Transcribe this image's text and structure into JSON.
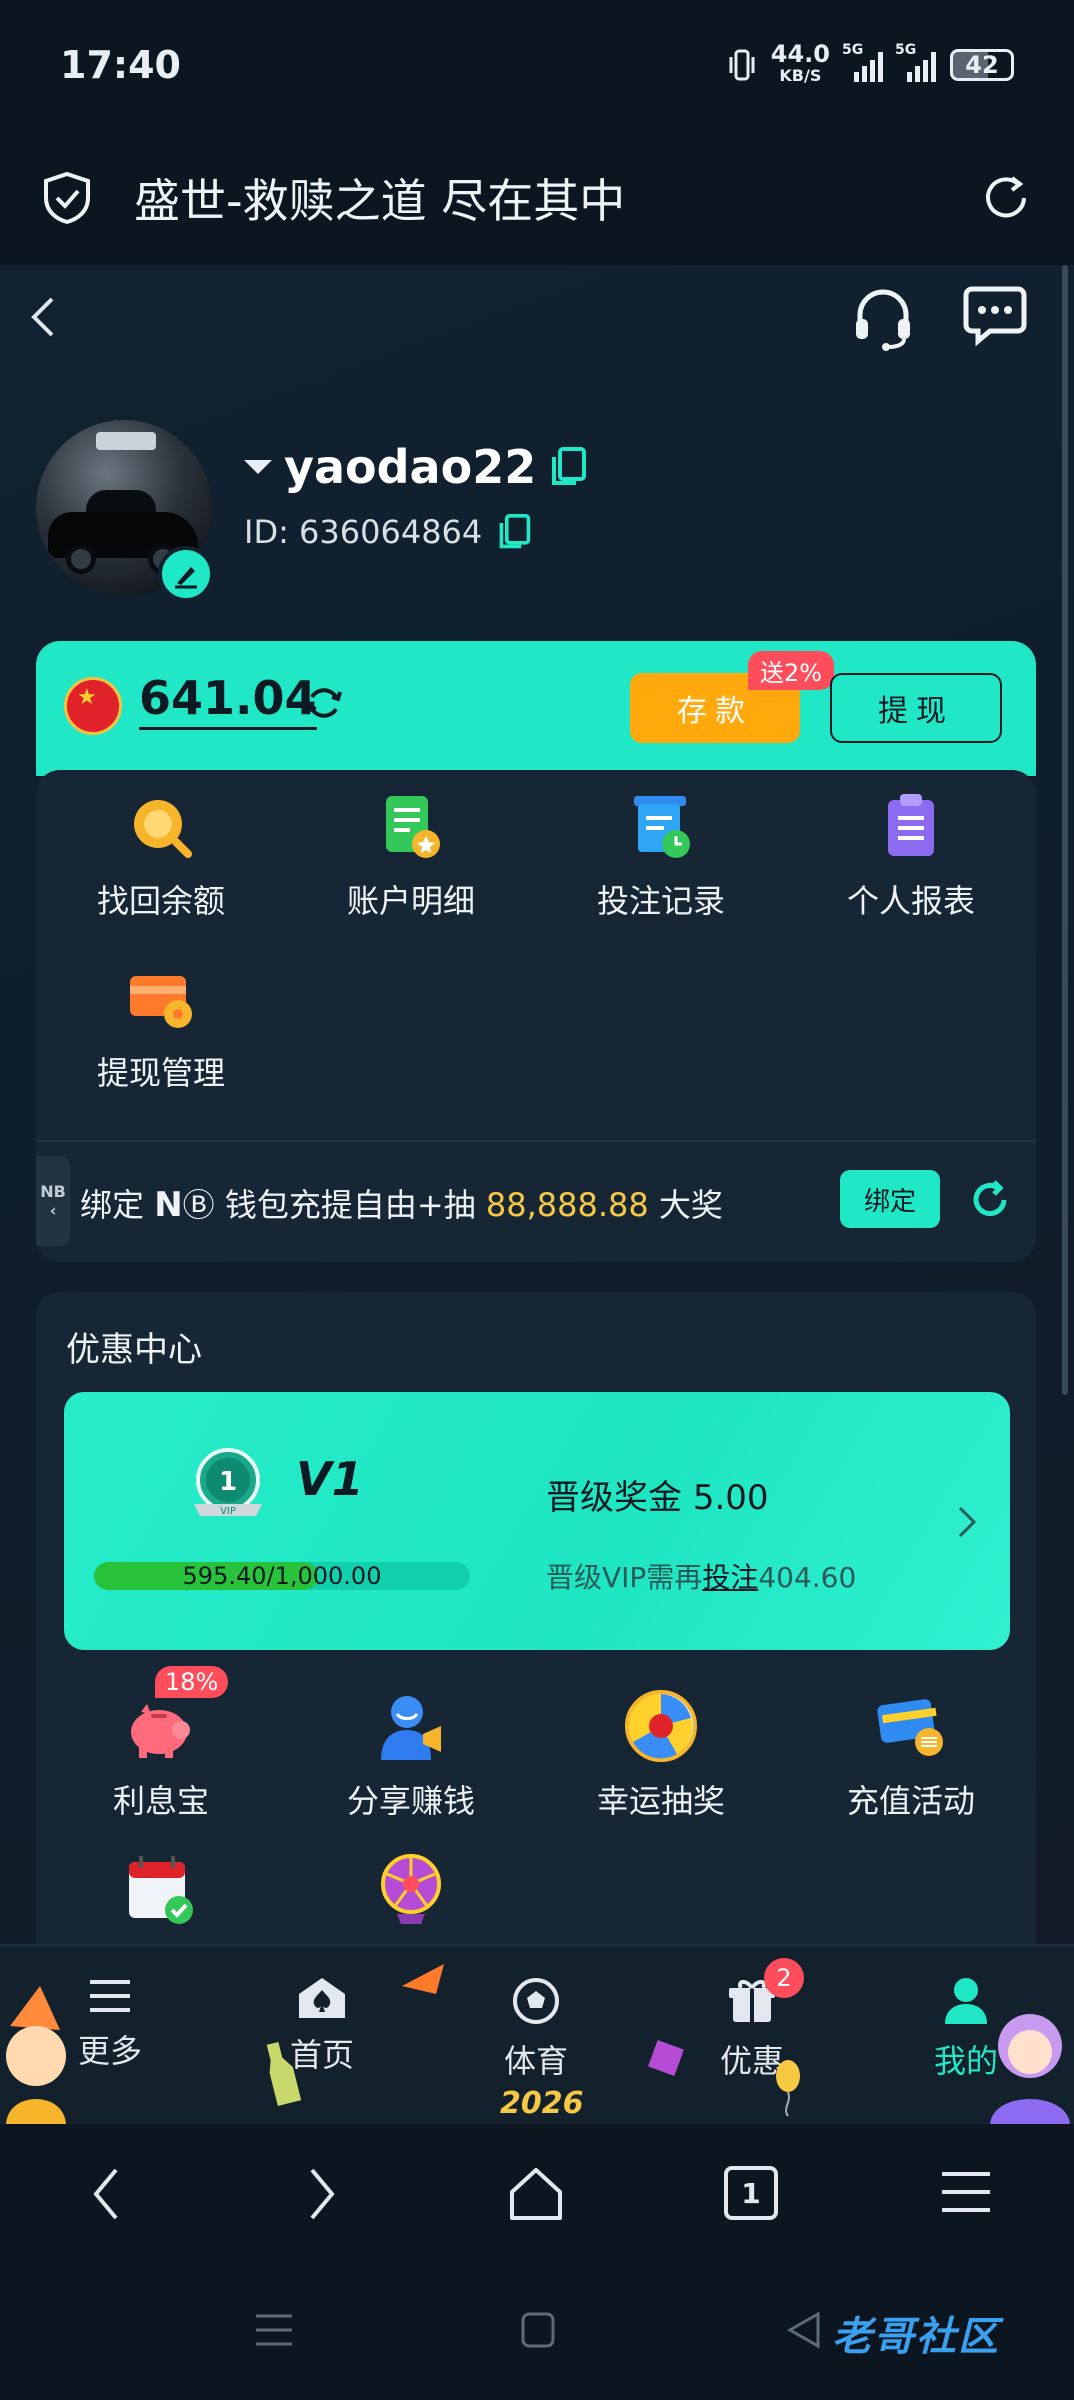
{
  "status_bar": {
    "time": "17:40",
    "net_speed": "44.0",
    "net_unit": "KB/S",
    "signal_1": "5G",
    "signal_2": "5G",
    "battery": "42"
  },
  "browser": {
    "title": "盛世-救赎之道 尽在其中"
  },
  "profile": {
    "username": "yaodao22",
    "id_label": "ID: 636064864"
  },
  "wallet": {
    "balance": "641.04",
    "deposit_label": "存款",
    "deposit_badge": "送2%",
    "withdraw_label": "提现"
  },
  "account_menu": [
    {
      "label": "找回余额",
      "icon": "coin-search-icon"
    },
    {
      "label": "账户明细",
      "icon": "statement-icon"
    },
    {
      "label": "投注记录",
      "icon": "bet-record-icon"
    },
    {
      "label": "个人报表",
      "icon": "report-icon"
    },
    {
      "label": "提现管理",
      "icon": "card-settings-icon"
    }
  ],
  "promo": {
    "tab_letters": "NB",
    "text_prefix": "绑定",
    "text_brand": "N",
    "text_mid": "钱包充提自由+抽",
    "text_amount": "88,888.88",
    "text_suffix": "大奖",
    "bind_label": "绑定"
  },
  "offers": {
    "title": "优惠中心",
    "vip": {
      "medal_number": "1",
      "medal_label": "VIP",
      "level": "V1",
      "progress_text": "595.40/1,000.00",
      "progress_fraction": 0.5954,
      "bonus_label": "晋级奖金",
      "bonus_value": "5.00",
      "need_prefix": "晋级VIP需再",
      "need_link": "投注",
      "need_value": "404.60"
    },
    "items": [
      {
        "label": "利息宝",
        "icon": "piggy-bank-icon",
        "badge": "18%"
      },
      {
        "label": "分享赚钱",
        "icon": "share-megaphone-icon"
      },
      {
        "label": "幸运抽奖",
        "icon": "lucky-wheel-icon"
      },
      {
        "label": "充值活动",
        "icon": "recharge-card-icon"
      }
    ]
  },
  "tabbar": [
    {
      "label": "更多",
      "icon": "menu-icon"
    },
    {
      "label": "首页",
      "icon": "home-spade-icon"
    },
    {
      "label": "体育",
      "icon": "soccer-ball-icon"
    },
    {
      "label": "优惠",
      "icon": "gift-icon",
      "badge": "2"
    },
    {
      "label": "我的",
      "icon": "user-icon",
      "active": true
    }
  ],
  "decor": {
    "year": "2026"
  },
  "browser_nav": {
    "tab_count": "1"
  },
  "watermark": "老哥社区"
}
